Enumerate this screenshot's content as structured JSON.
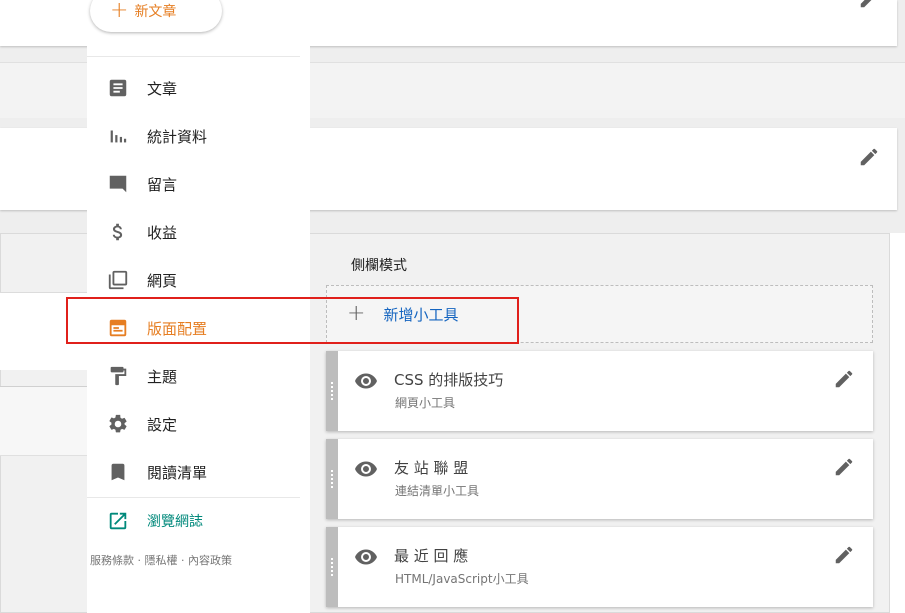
{
  "sidebar": {
    "new_post_label": "新文章",
    "items": [
      {
        "label": "文章",
        "icon": "article-icon"
      },
      {
        "label": "統計資料",
        "icon": "stats-icon"
      },
      {
        "label": "留言",
        "icon": "comment-icon"
      },
      {
        "label": "收益",
        "icon": "dollar-icon"
      },
      {
        "label": "網頁",
        "icon": "pages-icon"
      },
      {
        "label": "版面配置",
        "icon": "layout-icon",
        "active": true
      },
      {
        "label": "主題",
        "icon": "paint-roller-icon"
      },
      {
        "label": "設定",
        "icon": "gear-icon"
      },
      {
        "label": "閱讀清單",
        "icon": "bookmark-icon"
      }
    ],
    "view_blog_label": "瀏覽網誌",
    "footer": "服務條款 · 隱私權 · 內容政策"
  },
  "layout": {
    "section_title": "側欄模式",
    "add_gadget_label": "新增小工具",
    "gadgets": [
      {
        "title": "CSS 的排版技巧",
        "subtitle": "網頁小工具"
      },
      {
        "title": "友 站 聯 盟",
        "subtitle": "連結清單小工具"
      },
      {
        "title": "最 近 回 應",
        "subtitle": "HTML/JavaScript小工具"
      }
    ]
  },
  "colors": {
    "accent": "#e67e22",
    "link_blue": "#1565c0",
    "teal": "#00897b",
    "highlight_red": "#e0201b"
  }
}
